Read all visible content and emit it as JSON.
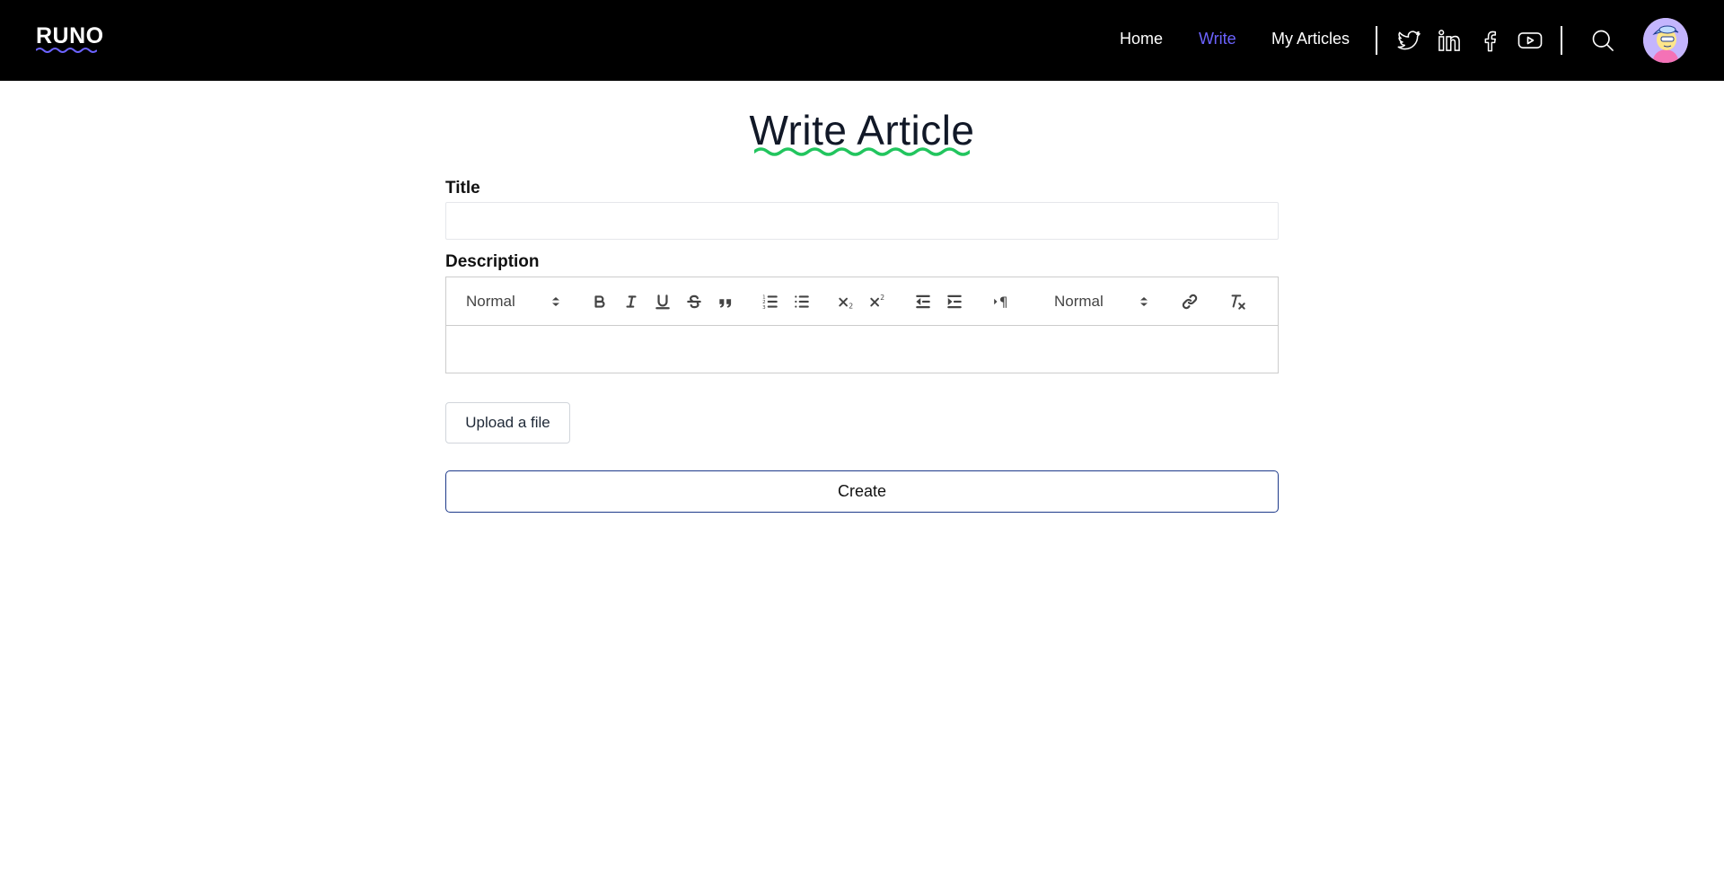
{
  "header": {
    "logo": "RUNO",
    "nav": [
      {
        "label": "Home",
        "active": false
      },
      {
        "label": "Write",
        "active": true
      },
      {
        "label": "My Articles",
        "active": false
      }
    ],
    "social_icons": [
      "twitter-icon",
      "linkedin-icon",
      "facebook-icon",
      "youtube-icon"
    ],
    "search_icon": "search-icon",
    "avatar_icon": "user-avatar"
  },
  "main": {
    "page_title": "Write Article",
    "title_label": "Title",
    "title_value": "",
    "description_label": "Description",
    "toolbar": {
      "header_select": "Normal",
      "size_select": "Normal",
      "buttons": [
        "bold",
        "italic",
        "underline",
        "strike",
        "blockquote",
        "ordered-list",
        "bullet-list",
        "subscript",
        "superscript",
        "outdent",
        "indent",
        "text-direction",
        "link",
        "clean-format"
      ]
    },
    "description_value": "",
    "upload_label": "Upload a file",
    "create_label": "Create"
  },
  "colors": {
    "header_bg": "#000000",
    "accent": "#6c63ff",
    "title_underline": "#22c55e",
    "create_border": "#1e3a8a"
  }
}
